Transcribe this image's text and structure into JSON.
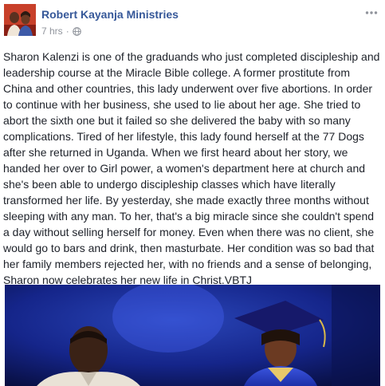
{
  "post": {
    "author": "Robert Kayanja Ministries",
    "timestamp": "7 hrs",
    "separator": "·",
    "privacy_icon": "globe-icon",
    "more_icon": "more-options-icon",
    "lines": [
      "Sharon Kalenzi is one of the graduands who just completed discipleship and",
      "leadership course at the Miracle Bible college. A former prostitute from",
      "China and other countries, this lady underwent over five abortions. In order",
      "to continue with her business, she used to lie about her age. She tried to",
      "abort the sixth one but it failed so she delivered the baby with so many",
      "complications. Tired of her lifestyle, this lady found herself at the 77 Dogs",
      "after she returned in Uganda. When we first heard about her story, we",
      "handed her over to Girl power, a women's department here at church and",
      "she's been able to undergo discipleship classes which have literally",
      "transformed her life. By yesterday, she made exactly three months without",
      "sleeping with any man. To her, that's a big miracle since she couldn't spend",
      "a day without selling herself for money. Even when there was no client, she",
      "would go to bars and drink, then masturbate. Her condition was so bad that",
      "her family members rejected her, with no friends and a sense of belonging,",
      "Sharon now celebrates her new life in Christ.VBTJ"
    ]
  },
  "colors": {
    "author_link": "#365899",
    "meta_text": "#90949c",
    "body_text": "#1d2129",
    "photo_background": "#0e1c6a"
  }
}
